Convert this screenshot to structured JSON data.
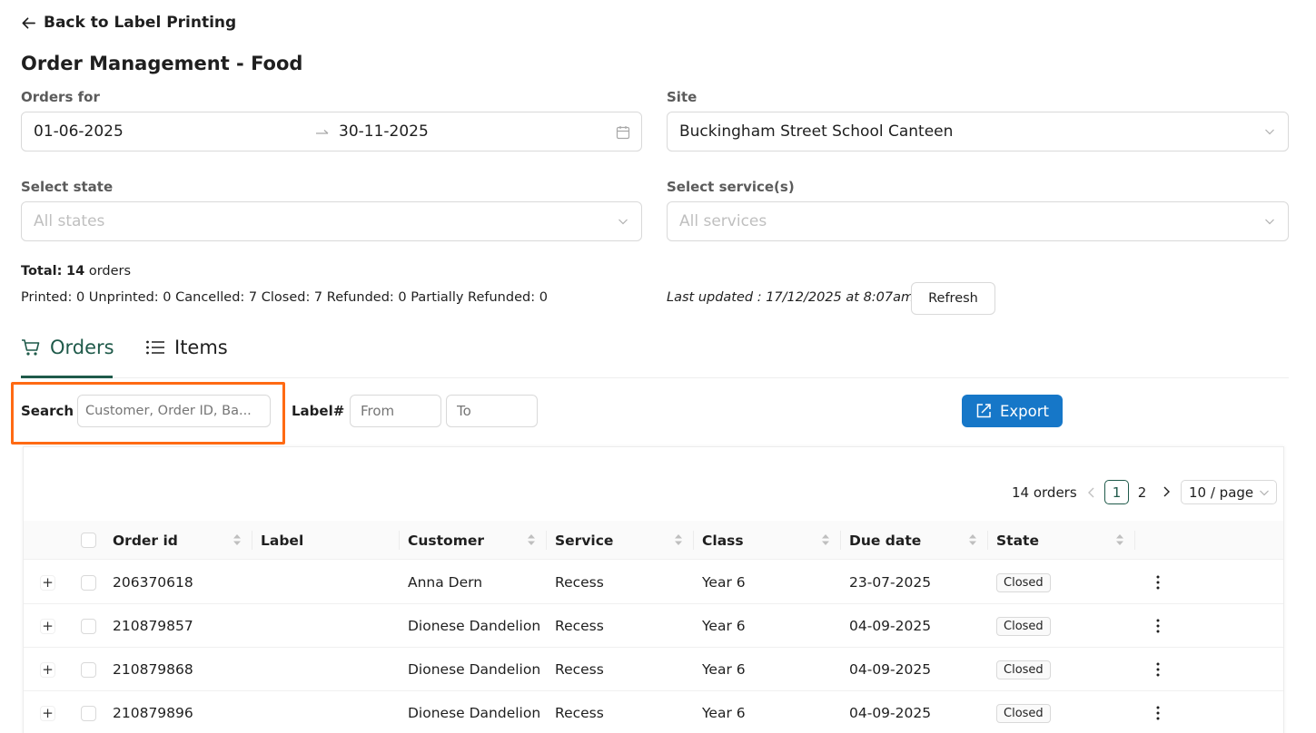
{
  "nav": {
    "back_label": "Back to Label Printing"
  },
  "page": {
    "title": "Order Management - Food"
  },
  "filters": {
    "orders_for_label": "Orders for",
    "date_from": "01-06-2025",
    "date_to": "30-11-2025",
    "site_label": "Site",
    "site_value": "Buckingham Street School Canteen",
    "state_label": "Select state",
    "state_placeholder": "All states",
    "service_label": "Select service(s)",
    "service_placeholder": "All services"
  },
  "summary": {
    "total_prefix": "Total:",
    "total_count": "14",
    "total_suffix": "orders",
    "breakdown": "Printed: 0 Unprinted: 0 Cancelled: 7 Closed: 7 Refunded: 0 Partially Refunded: 0",
    "last_updated": "Last updated : 17/12/2025 at 8:07am",
    "refresh_label": "Refresh"
  },
  "tabs": [
    {
      "label": "Orders",
      "icon": "cart-icon",
      "active": true
    },
    {
      "label": "Items",
      "icon": "list-icon",
      "active": false
    }
  ],
  "toolbar": {
    "search_label": "Search",
    "search_placeholder": "Customer, Order ID, Ba...",
    "label_num_label": "Label#",
    "from_placeholder": "From",
    "to_placeholder": "To",
    "export_label": "Export"
  },
  "pagination": {
    "total_text": "14 orders",
    "pages": [
      "1",
      "2"
    ],
    "current_page": "1",
    "page_size": "10 / page"
  },
  "table": {
    "columns": [
      "Order id",
      "Label",
      "Customer",
      "Service",
      "Class",
      "Due date",
      "State"
    ],
    "rows": [
      {
        "order_id": "206370618",
        "label": "",
        "customer": "Anna Dern",
        "service": "Recess",
        "class": "Year 6",
        "due_date": "23-07-2025",
        "state": "Closed"
      },
      {
        "order_id": "210879857",
        "label": "",
        "customer": "Dionese Dandelion",
        "service": "Recess",
        "class": "Year 6",
        "due_date": "04-09-2025",
        "state": "Closed"
      },
      {
        "order_id": "210879868",
        "label": "",
        "customer": "Dionese Dandelion",
        "service": "Recess",
        "class": "Year 6",
        "due_date": "04-09-2025",
        "state": "Closed"
      },
      {
        "order_id": "210879896",
        "label": "",
        "customer": "Dionese Dandelion",
        "service": "Recess",
        "class": "Year 6",
        "due_date": "04-09-2025",
        "state": "Closed"
      }
    ]
  },
  "colors": {
    "primary": "#1677c8",
    "tab_active": "#1f5a4a",
    "highlight": "#ff6a13"
  }
}
